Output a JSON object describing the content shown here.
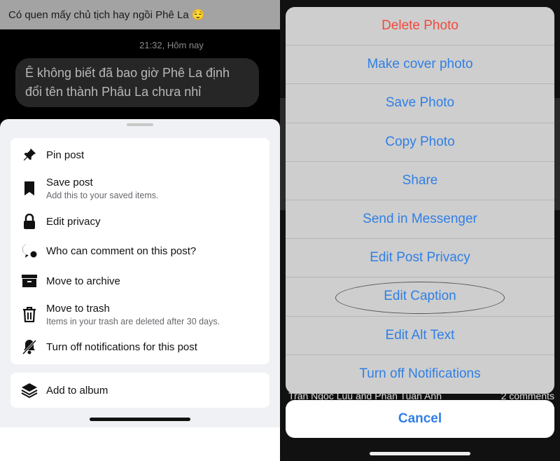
{
  "chat": {
    "header": "Có quen mấy chủ tịch hay ngồi Phê La 😌",
    "timestamp": "21:32, Hôm nay",
    "message": "Ê không biết đã bao giờ Phê La định đổi tên thành Phâu La chưa nhỉ"
  },
  "post_menu": {
    "items": [
      {
        "icon": "pin-icon",
        "label": "Pin post",
        "sub": ""
      },
      {
        "icon": "bookmark-icon",
        "label": "Save post",
        "sub": "Add this to your saved items."
      },
      {
        "icon": "lock-icon",
        "label": "Edit privacy",
        "sub": ""
      },
      {
        "icon": "comment-shield-icon",
        "label": "Who can comment on this post?",
        "sub": ""
      },
      {
        "icon": "archive-icon",
        "label": "Move to archive",
        "sub": ""
      },
      {
        "icon": "trash-icon",
        "label": "Move to trash",
        "sub": "Items in your trash are deleted after 30 days."
      },
      {
        "icon": "bell-off-icon",
        "label": "Turn off notifications for this post",
        "sub": ""
      }
    ],
    "album": {
      "icon": "layers-icon",
      "label": "Add to album"
    }
  },
  "photo_actions": {
    "items": [
      "Delete Photo",
      "Make cover photo",
      "Save Photo",
      "Copy Photo",
      "Share",
      "Send in Messenger",
      "Edit Post Privacy",
      "Edit Caption",
      "Edit Alt Text",
      "Turn off Notifications"
    ],
    "cancel": "Cancel",
    "destructive_color": "#f04a3e",
    "accent": "#2f7fe6"
  },
  "background_post": {
    "reactions": "Tran Ngoc Luu and Phan Tuan Anh",
    "comments": "2 comments"
  }
}
